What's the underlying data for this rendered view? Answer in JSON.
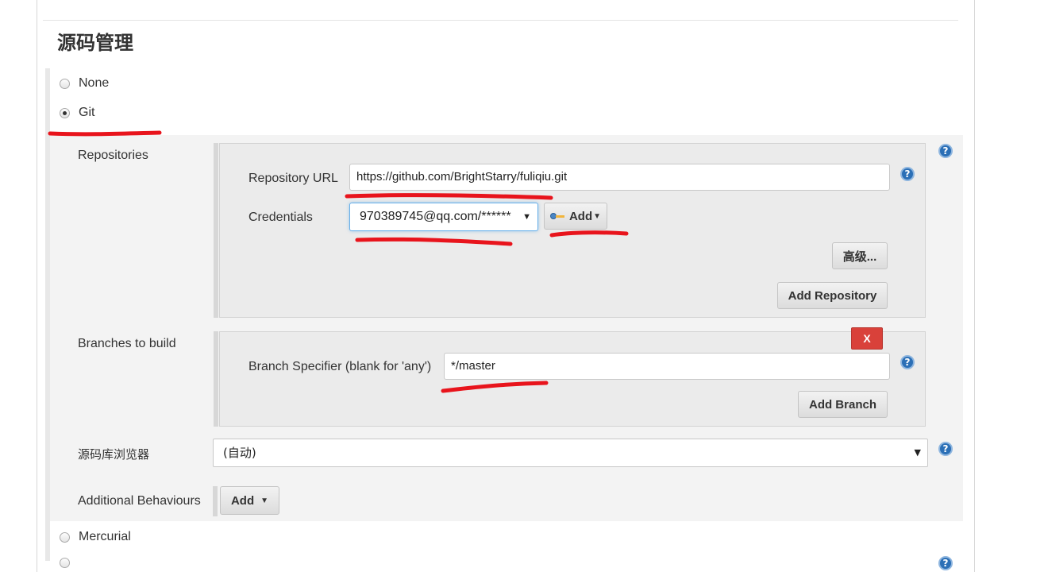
{
  "section": {
    "title": "源码管理"
  },
  "scm_options": {
    "none": "None",
    "git": "Git",
    "mercurial": "Mercurial"
  },
  "repositories": {
    "label": "Repositories",
    "url_label": "Repository URL",
    "url_value": "https://github.com/BrightStarry/fuliqiu.git",
    "credentials_label": "Credentials",
    "credentials_value": "970389745@qq.com/******",
    "add_credentials_label": "Add",
    "advanced_label": "高级...",
    "add_repository_label": "Add Repository"
  },
  "branches": {
    "label": "Branches to build",
    "delete_label": "X",
    "specifier_label": "Branch Specifier (blank for 'any')",
    "specifier_value": "*/master",
    "add_branch_label": "Add Branch"
  },
  "browser": {
    "label": "源码库浏览器",
    "value": "(自动)"
  },
  "behaviours": {
    "label": "Additional Behaviours",
    "add_label": "Add"
  },
  "icons": {
    "help": "?",
    "dropdown": "▼"
  },
  "colors": {
    "highlight": "#e8141c",
    "focus_border": "#66afe9",
    "delete_button": "#d9413a",
    "help_icon": "#2b6fb6"
  }
}
